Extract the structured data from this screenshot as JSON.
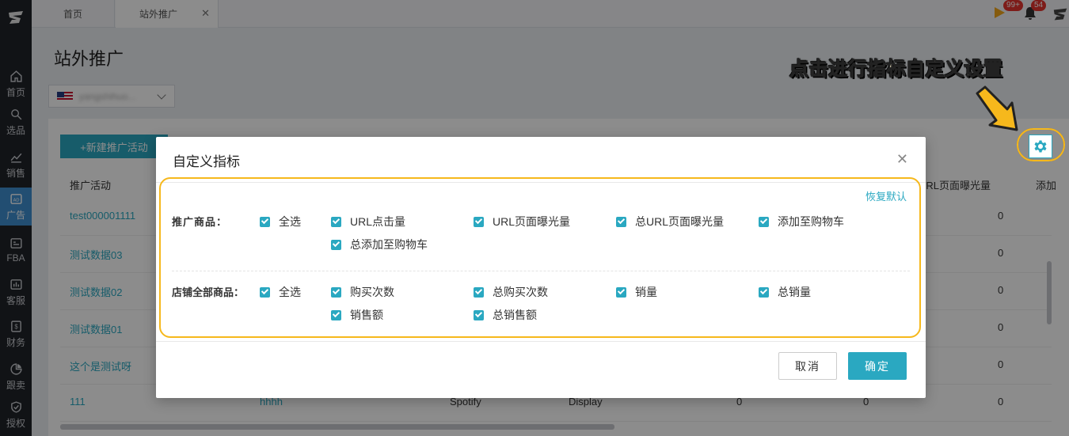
{
  "tabs": [
    {
      "label": "首页"
    },
    {
      "label": "站外推广"
    }
  ],
  "topbar": {
    "notice_badge": "99+",
    "bell_badge": "54"
  },
  "sidebar": {
    "items": [
      {
        "label": "首页",
        "icon": "home-icon"
      },
      {
        "label": "选品",
        "icon": "search-icon"
      },
      {
        "label": "销售",
        "icon": "chart-icon"
      },
      {
        "label": "广告",
        "icon": "ad-icon"
      },
      {
        "label": "FBA",
        "icon": "fba-icon"
      },
      {
        "label": "客服",
        "icon": "service-icon"
      },
      {
        "label": "财务",
        "icon": "finance-icon"
      },
      {
        "label": "跟卖",
        "icon": "follow-sell-icon"
      },
      {
        "label": "授权",
        "icon": "shield-icon"
      }
    ]
  },
  "page": {
    "title": "站外推广",
    "store": "yangshihuo...",
    "new_button": "+新建推广活动"
  },
  "table": {
    "headers": [
      "推广活动",
      "URL页面曝光量",
      "添加"
    ],
    "rows": [
      {
        "name": "test000001111",
        "cols": [
          "",
          "",
          "",
          "",
          "",
          "0"
        ]
      },
      {
        "name": "测试数据03",
        "cols": [
          "",
          "",
          "",
          "",
          "",
          "0"
        ]
      },
      {
        "name": "测试数据02",
        "cols": [
          "",
          "",
          "",
          "",
          "",
          "0"
        ]
      },
      {
        "name": "测试数据01",
        "cols": [
          "",
          "",
          "",
          "",
          "",
          "0"
        ]
      },
      {
        "name": "这个是测试呀",
        "cols": [
          "",
          "",
          "",
          "",
          "",
          "0"
        ]
      },
      {
        "name": "111",
        "cols": [
          "hhhh",
          "Spotify",
          "Display",
          "0",
          "0",
          "0"
        ]
      }
    ]
  },
  "callout": "点击进行指标自定义设置",
  "modal": {
    "title": "自定义指标",
    "restore": "恢复默认",
    "group1_label": "推广商品：",
    "group1_items": [
      "全选",
      "URL点击量",
      "URL页面曝光量",
      "总URL页面曝光量",
      "添加至购物车",
      "总添加至购物车"
    ],
    "group2_label": "店铺全部商品：",
    "group2_items": [
      "全选",
      "购买次数",
      "总购买次数",
      "销量",
      "总销量",
      "销售额",
      "总销售额"
    ],
    "cancel": "取消",
    "ok": "确定"
  },
  "colors": {
    "accent": "#2aa8c1",
    "highlight": "#f6b81c",
    "sidebar": "#1f2329",
    "sidebar_active": "#3f8fd0"
  }
}
